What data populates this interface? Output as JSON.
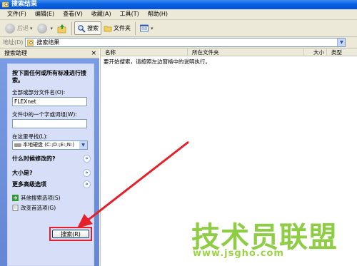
{
  "window": {
    "title": "搜索结果"
  },
  "menu": [
    "文件(F)",
    "编辑(E)",
    "查看(V)",
    "收藏(A)",
    "工具(T)",
    "帮助(H)"
  ],
  "toolbar": {
    "back_label": "后退",
    "search_label": "搜索",
    "folders_label": "文件夹"
  },
  "address": {
    "label": "地址(D)",
    "value": "搜索结果"
  },
  "search_pane": {
    "title": "搜索助理",
    "close_glyph": "×",
    "heading": "按下面任何或所有标准进行搜索。",
    "name_label": "全部或部分文件名(O):",
    "name_value": "FLEXnet",
    "phrase_label": "文件中的一个字或词组(W):",
    "phrase_value": "",
    "lookin_label": "在这里寻找(L):",
    "lookin_value": "本地硬盘 (C:;D:;E:;N:)",
    "options": [
      "什么时候修改的?",
      "大小是?",
      "更多高级选项"
    ],
    "links": [
      "其他搜索选项(S)",
      "改变首选项(G)"
    ],
    "search_button": "搜索(R)"
  },
  "results": {
    "columns": [
      "名称",
      "所在文件夹",
      "大小",
      "类型"
    ],
    "message": "要开始搜索，请按照左边窗格中的说明执行。"
  },
  "watermark": {
    "text": "技术员联盟",
    "url": "www.jsgho.com"
  },
  "colors": {
    "titlebar": "#0a5fe0",
    "pane": "#6b8ed6",
    "highlight": "#e5202a",
    "watermark": "#86c934"
  }
}
